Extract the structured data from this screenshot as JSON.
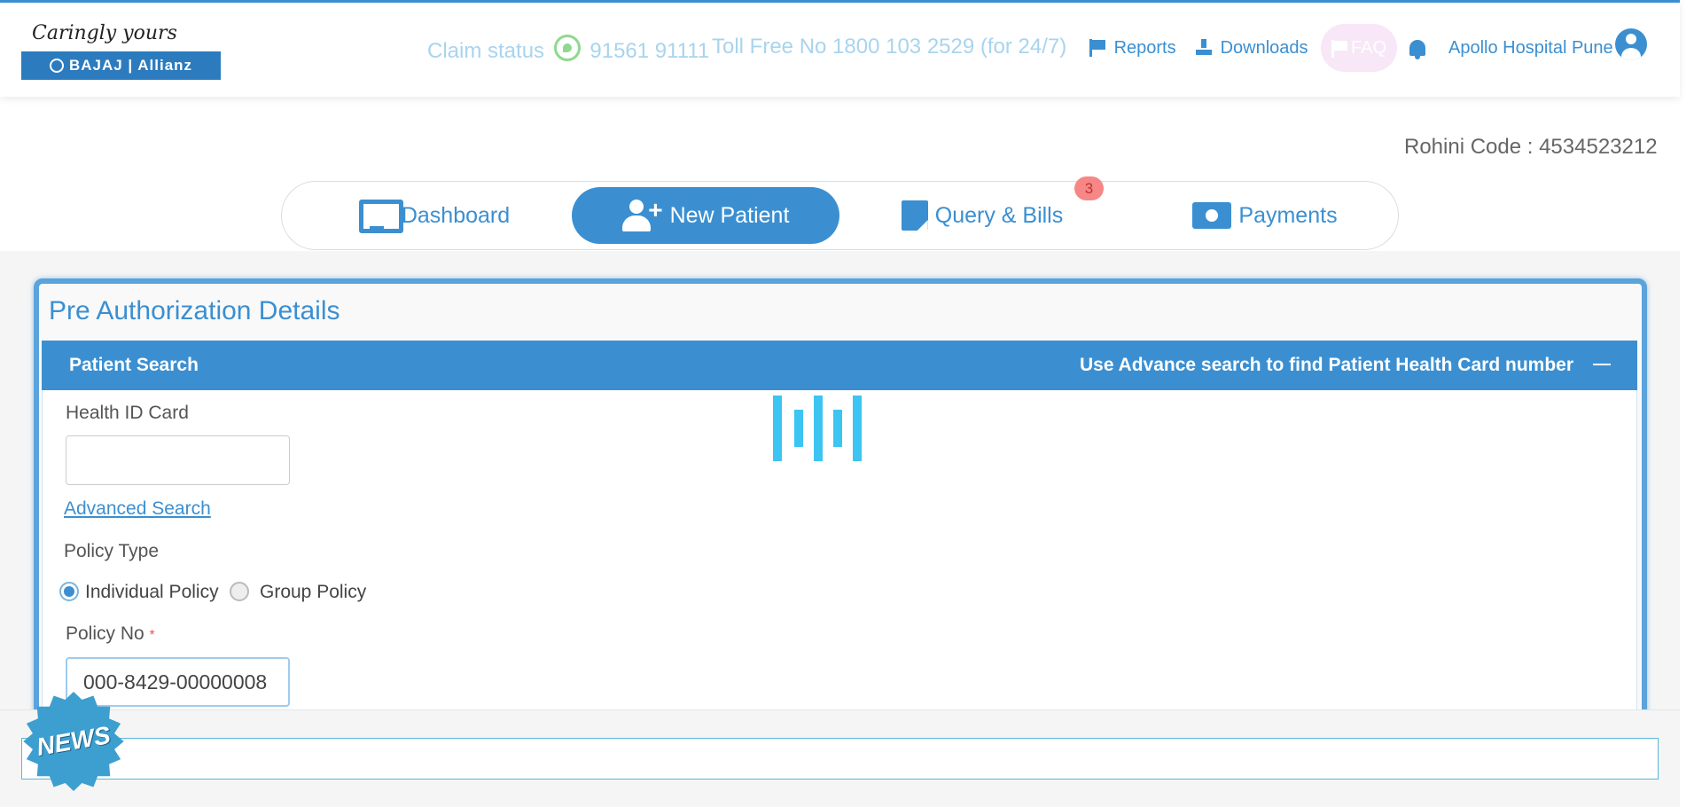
{
  "header": {
    "logo_tagline": "Caringly yours",
    "logo_brand": "BAJAJ | Allianz",
    "claim_status_label": "Claim status",
    "claim_phone": "91561 91111",
    "toll_free": "Toll Free No 1800 103 2529 (for 24/7)",
    "reports": "Reports",
    "downloads": "Downloads",
    "faq": "FAQ",
    "user_name": "Apollo Hospital Pune"
  },
  "rohini_code": "Rohini Code : 4534523212",
  "tabs": [
    {
      "label": "Dashboard",
      "icon": "monitor-icon"
    },
    {
      "label": "New Patient",
      "icon": "user-plus-icon",
      "active": true
    },
    {
      "label": "Query & Bills",
      "icon": "note-icon",
      "badge": "3"
    },
    {
      "label": "Payments",
      "icon": "money-icon"
    }
  ],
  "page": {
    "title": "Pre Authorization Details",
    "section_title": "Patient Search",
    "section_hint": "Use Advance search to find Patient Health Card number",
    "health_id_label": "Health ID Card",
    "health_id_value": "",
    "advanced_search": "Advanced Search",
    "policy_type_label": "Policy Type",
    "policy_types": [
      "Individual Policy",
      "Group Policy"
    ],
    "selected_policy_type": "Individual Policy",
    "policy_no_label": "Policy No",
    "policy_no_required": "*",
    "policy_no_value": "000-8429-00000008"
  },
  "news": {
    "badge": "NEWS"
  },
  "colors": {
    "primary": "#3b8fd1",
    "badge": "#f78686",
    "loader": "#3cc4f2"
  }
}
